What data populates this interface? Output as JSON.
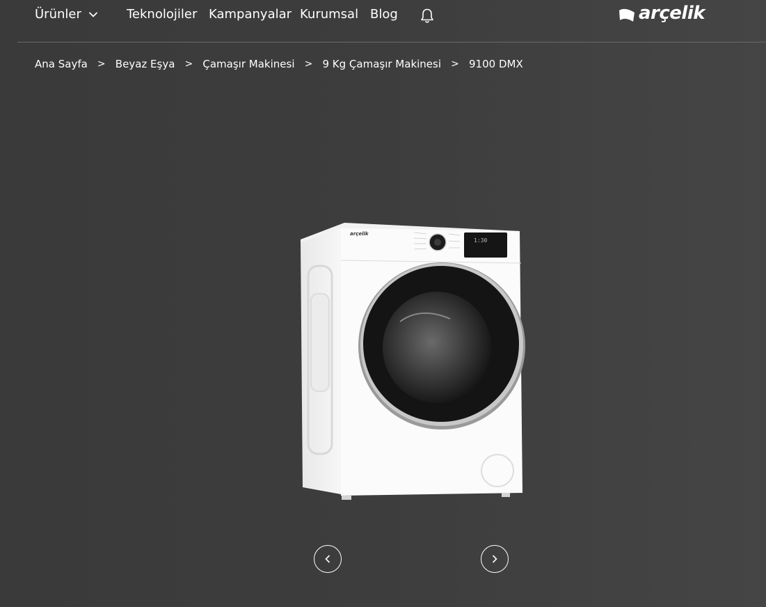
{
  "nav": {
    "items": [
      {
        "label": "Ürünler"
      },
      {
        "label": "Teknolojiler"
      },
      {
        "label": "Kampanyalar"
      },
      {
        "label": "Kurumsal"
      },
      {
        "label": "Blog"
      }
    ],
    "icons": {
      "dropdown": "chevron-down-icon",
      "notifications": "bell-icon"
    }
  },
  "brand": {
    "logo_text": "arçelik",
    "color": "#ffffff"
  },
  "breadcrumb": {
    "items": [
      "Ana Sayfa",
      "Beyaz Eşya",
      "Çamaşır Makinesi",
      "9 Kg Çamaşır Makinesi",
      "9100 DMX"
    ],
    "separator": ">"
  },
  "product": {
    "image_icon": "washing-machine-image",
    "panel_brand": "arçelik",
    "display_text": "1:30"
  },
  "carousel": {
    "prev_icon": "chevron-left-icon",
    "next_icon": "chevron-right-icon"
  },
  "colors": {
    "background": "#3d3d3d",
    "text": "#ffffff",
    "divider": "#6a6a6a"
  }
}
